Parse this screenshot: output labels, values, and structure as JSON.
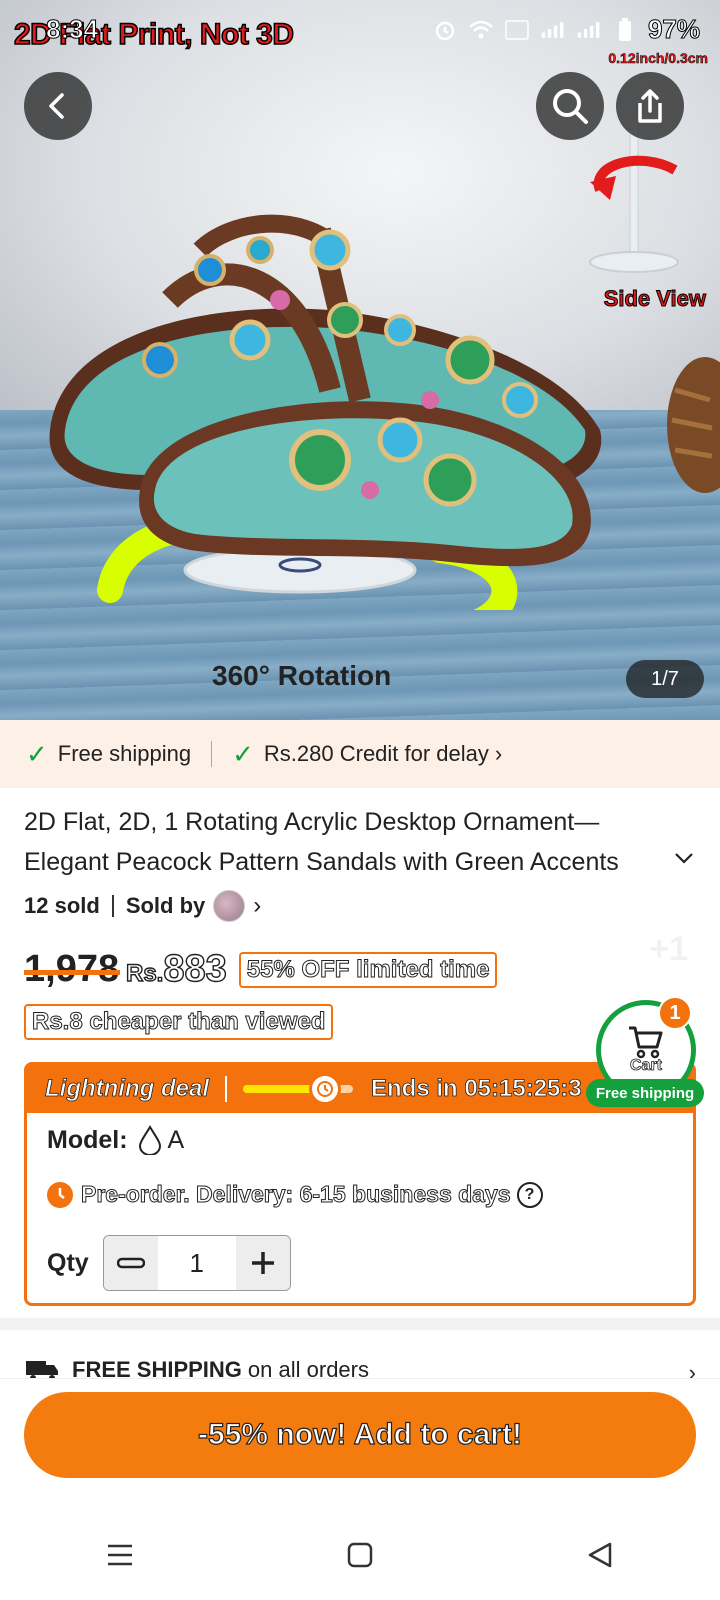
{
  "status_bar": {
    "time": "8:34",
    "battery": "97%"
  },
  "hero": {
    "overlay_title": "2D Flat Print, Not 3D",
    "size_note": "0.12inch/0.3cm",
    "side_view_label": "Side View",
    "rotation_label": "360° Rotation",
    "page_indicator": "1/7"
  },
  "shipping_strip": {
    "free_shipping": "Free shipping",
    "credit": "Rs.280 Credit for delay"
  },
  "product": {
    "title": "2D Flat, 2D, 1 Rotating Acrylic Desktop Ornament—Elegant Peacock Pattern Sandals with Green Accents",
    "sold": "12 sold",
    "sold_by": "Sold by"
  },
  "pricing": {
    "old_price": "1,978",
    "currency": "Rs.",
    "new_price": "883",
    "discount_badge": "55% OFF limited time",
    "cheaper_badge": "Rs.8 cheaper than viewed",
    "plus_one": "+1"
  },
  "deal": {
    "label": "Lightning deal",
    "progress": 0.75,
    "ends_text": "Ends in 05:15:25:3",
    "model_label": "Model:",
    "model_value": "A",
    "preorder": "Pre-order. Delivery: 6-15 business days",
    "qty_label": "Qty",
    "qty_value": "1"
  },
  "cart": {
    "label": "Cart",
    "count": "1",
    "free_shipping": "Free shipping"
  },
  "free_shipping_row": {
    "bold": "FREE SHIPPING",
    "rest": "on all orders"
  },
  "cta": {
    "label": "-55% now! Add to cart!"
  },
  "colors": {
    "accent": "#f4720d",
    "success": "#14a03c",
    "brand_red": "#e21b1b"
  }
}
